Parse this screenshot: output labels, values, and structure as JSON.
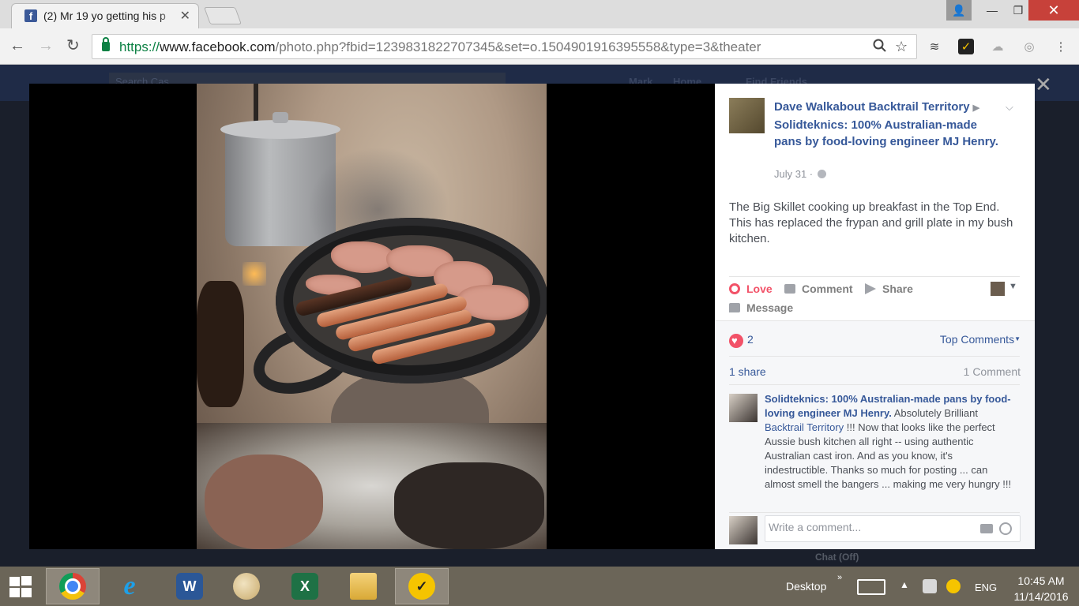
{
  "browser": {
    "tab_title": "(2) Mr 19 yo getting his p",
    "tab_close": "✕",
    "url_proto": "https://",
    "url_host": "www.facebook.com",
    "url_path": "/photo.php?fbid=1239831822707345&set=o.1504901916395558&type=3&theater",
    "window_user": "👤",
    "window_min": "—",
    "window_max": "❐",
    "window_close": "✕",
    "back": "←",
    "forward": "→",
    "reload": "↻",
    "omni_search_icon": "search-icon",
    "omni_star_icon": "star-icon"
  },
  "background_page": {
    "search_placeholder": "Search Cas...",
    "nav_name": "Mark",
    "nav_home": "Home",
    "nav_find": "Find Friends"
  },
  "theater": {
    "close": "✕"
  },
  "post": {
    "author": "Dave Walkabout Backtrail Territory",
    "page": "Solidteknics: 100% Australian-made pans by food-loving engineer MJ Henry.",
    "date": "July 31 ·",
    "text": "The Big Skillet cooking up breakfast in the Top End. This has replaced the frypan and grill plate in my bush kitchen.",
    "actions": {
      "love": "Love",
      "comment": "Comment",
      "share": "Share",
      "message": "Message"
    }
  },
  "ufi": {
    "reaction_count": "2",
    "top_comments": "Top Comments",
    "shares": "1 share",
    "comments": "1 Comment",
    "comment": {
      "author": "Solidteknics: 100% Australian-made pans by food-loving engineer MJ Henry.",
      "text_before": " Absolutely Brilliant ",
      "mention": "Backtrail Territory",
      "text_after": " !!! Now that looks like the perfect Aussie bush kitchen all right -- using authentic Australian cast iron. And as you know, it's indestructible. Thanks so much for posting ... can almost smell the bangers ... making me very hungry !!!"
    },
    "write_placeholder": "Write a comment..."
  },
  "chat": "Chat (Off)",
  "taskbar": {
    "desktop": "Desktop",
    "lang": "ENG",
    "time": "10:45 AM",
    "date": "11/14/2016",
    "word_letter": "W",
    "excel_letter": "X",
    "norton_letter": "✓",
    "chevron": "»",
    "up": "▲"
  },
  "colors": {
    "facebook_blue": "#365899",
    "love_red": "#f25268",
    "taskbar": "#6b6558",
    "chrome_close": "#c7413a"
  }
}
